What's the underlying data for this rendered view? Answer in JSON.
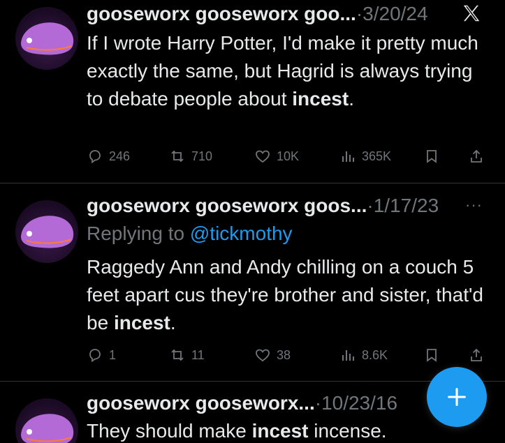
{
  "tweets": [
    {
      "author": "gooseworx gooseworx goo...",
      "separator": "·",
      "date": "3/20/24",
      "text_parts": [
        "If I wrote Harry Potter, I'd make it pretty much exactly the same, but Hagrid is always trying to debate people about ",
        "incest",
        "."
      ],
      "stats": {
        "replies": "246",
        "reposts": "710",
        "likes": "10K",
        "views": "365K"
      }
    },
    {
      "author": "gooseworx gooseworx goos...",
      "separator": "·",
      "date": "1/17/23",
      "more": "···",
      "reply_prefix": "Replying to ",
      "reply_handle": "@tickmothy",
      "text_parts": [
        "Raggedy Ann and Andy chilling on a couch 5 feet apart cus they're brother and sister, that'd be ",
        "incest",
        "."
      ],
      "stats": {
        "replies": "1",
        "reposts": "11",
        "likes": "38",
        "views": "8.6K"
      }
    },
    {
      "author": "gooseworx gooseworx...",
      "separator": "·",
      "date": "10/23/16",
      "text_parts": [
        "They should make ",
        "incest",
        " incense."
      ]
    }
  ],
  "icons": {
    "platform": "x-logo-icon",
    "reply": "reply-icon",
    "repost": "repost-icon",
    "like": "heart-icon",
    "views": "views-icon",
    "bookmark": "bookmark-icon",
    "share": "share-icon",
    "compose": "plus-icon"
  },
  "colors": {
    "background": "#000000",
    "text": "#e7e9ea",
    "muted": "#71767b",
    "accent": "#1d9bf0"
  }
}
